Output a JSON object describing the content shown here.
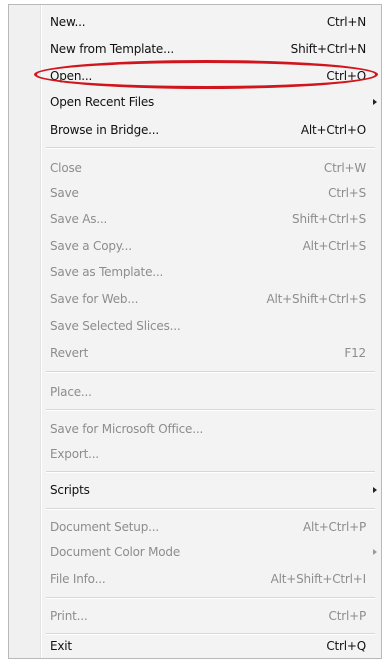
{
  "menu": {
    "items": [
      {
        "label": "New...",
        "shortcut": "Ctrl+N",
        "enabled": true
      },
      {
        "label": "New from Template...",
        "shortcut": "Shift+Ctrl+N",
        "enabled": true
      },
      {
        "label": "Open...",
        "shortcut": "Ctrl+O",
        "enabled": true
      },
      {
        "label": "Open Recent Files",
        "shortcut": "",
        "enabled": true,
        "submenu": true
      },
      {
        "label": "Browse in Bridge...",
        "shortcut": "Alt+Ctrl+O",
        "enabled": true
      },
      {
        "label": "Close",
        "shortcut": "Ctrl+W",
        "enabled": false
      },
      {
        "label": "Save",
        "shortcut": "Ctrl+S",
        "enabled": false
      },
      {
        "label": "Save As...",
        "shortcut": "Shift+Ctrl+S",
        "enabled": false
      },
      {
        "label": "Save a Copy...",
        "shortcut": "Alt+Ctrl+S",
        "enabled": false
      },
      {
        "label": "Save as Template...",
        "shortcut": "",
        "enabled": false
      },
      {
        "label": "Save for Web...",
        "shortcut": "Alt+Shift+Ctrl+S",
        "enabled": false
      },
      {
        "label": "Save Selected Slices...",
        "shortcut": "",
        "enabled": false
      },
      {
        "label": "Revert",
        "shortcut": "F12",
        "enabled": false
      },
      {
        "label": "Place...",
        "shortcut": "",
        "enabled": false
      },
      {
        "label": "Save for Microsoft Office...",
        "shortcut": "",
        "enabled": false
      },
      {
        "label": "Export...",
        "shortcut": "",
        "enabled": false
      },
      {
        "label": "Scripts",
        "shortcut": "",
        "enabled": true,
        "submenu": true
      },
      {
        "label": "Document Setup...",
        "shortcut": "Alt+Ctrl+P",
        "enabled": false
      },
      {
        "label": "Document Color Mode",
        "shortcut": "",
        "enabled": false,
        "submenu": true
      },
      {
        "label": "File Info...",
        "shortcut": "Alt+Shift+Ctrl+I",
        "enabled": false
      },
      {
        "label": "Print...",
        "shortcut": "Ctrl+P",
        "enabled": false
      },
      {
        "label": "Exit",
        "shortcut": "Ctrl+Q",
        "enabled": true
      }
    ],
    "highlighted_item": "Open...",
    "highlight_color": "#d0151d"
  }
}
